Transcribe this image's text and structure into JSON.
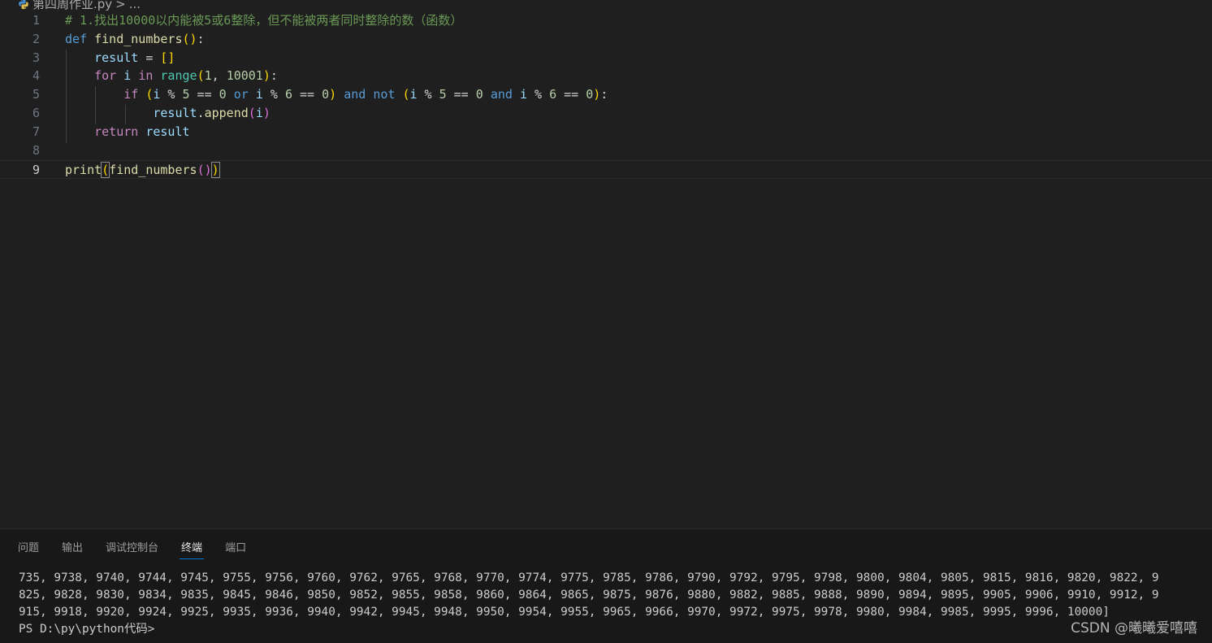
{
  "breadcrumb": {
    "file": "第四周作业.py",
    "separator": ">",
    "rest": "..."
  },
  "editor": {
    "lines": [
      {
        "n": "1",
        "tokens": [
          {
            "c": "t-comment",
            "t": "# 1.找出10000以内能被5或6整除，但不能被两者同时整除的数（函数）"
          }
        ]
      },
      {
        "n": "2",
        "tokens": [
          {
            "c": "t-def",
            "t": "def"
          },
          {
            "c": "t-plain",
            "t": " "
          },
          {
            "c": "t-fn",
            "t": "find_numbers"
          },
          {
            "c": "t-p1",
            "t": "()"
          },
          {
            "c": "t-plain",
            "t": ":"
          }
        ]
      },
      {
        "n": "3",
        "tokens": [
          {
            "c": "t-plain",
            "t": "    "
          },
          {
            "c": "t-var",
            "t": "result"
          },
          {
            "c": "t-op",
            "t": " = "
          },
          {
            "c": "t-p1",
            "t": "[]"
          }
        ]
      },
      {
        "n": "4",
        "tokens": [
          {
            "c": "t-plain",
            "t": "    "
          },
          {
            "c": "t-kw",
            "t": "for"
          },
          {
            "c": "t-plain",
            "t": " "
          },
          {
            "c": "t-var",
            "t": "i"
          },
          {
            "c": "t-plain",
            "t": " "
          },
          {
            "c": "t-kw",
            "t": "in"
          },
          {
            "c": "t-plain",
            "t": " "
          },
          {
            "c": "t-builtin",
            "t": "range"
          },
          {
            "c": "t-p1",
            "t": "("
          },
          {
            "c": "t-num",
            "t": "1"
          },
          {
            "c": "t-plain",
            "t": ", "
          },
          {
            "c": "t-num",
            "t": "10001"
          },
          {
            "c": "t-p1",
            "t": ")"
          },
          {
            "c": "t-plain",
            "t": ":"
          }
        ]
      },
      {
        "n": "5",
        "tokens": [
          {
            "c": "t-plain",
            "t": "        "
          },
          {
            "c": "t-kw",
            "t": "if"
          },
          {
            "c": "t-plain",
            "t": " "
          },
          {
            "c": "t-p1",
            "t": "("
          },
          {
            "c": "t-var",
            "t": "i"
          },
          {
            "c": "t-op",
            "t": " % "
          },
          {
            "c": "t-num",
            "t": "5"
          },
          {
            "c": "t-op",
            "t": " == "
          },
          {
            "c": "t-num",
            "t": "0"
          },
          {
            "c": "t-plain",
            "t": " "
          },
          {
            "c": "t-bool",
            "t": "or"
          },
          {
            "c": "t-plain",
            "t": " "
          },
          {
            "c": "t-var",
            "t": "i"
          },
          {
            "c": "t-op",
            "t": " % "
          },
          {
            "c": "t-num",
            "t": "6"
          },
          {
            "c": "t-op",
            "t": " == "
          },
          {
            "c": "t-num",
            "t": "0"
          },
          {
            "c": "t-p1",
            "t": ")"
          },
          {
            "c": "t-plain",
            "t": " "
          },
          {
            "c": "t-bool",
            "t": "and"
          },
          {
            "c": "t-plain",
            "t": " "
          },
          {
            "c": "t-bool",
            "t": "not"
          },
          {
            "c": "t-plain",
            "t": " "
          },
          {
            "c": "t-p1",
            "t": "("
          },
          {
            "c": "t-var",
            "t": "i"
          },
          {
            "c": "t-op",
            "t": " % "
          },
          {
            "c": "t-num",
            "t": "5"
          },
          {
            "c": "t-op",
            "t": " == "
          },
          {
            "c": "t-num",
            "t": "0"
          },
          {
            "c": "t-plain",
            "t": " "
          },
          {
            "c": "t-bool",
            "t": "and"
          },
          {
            "c": "t-plain",
            "t": " "
          },
          {
            "c": "t-var",
            "t": "i"
          },
          {
            "c": "t-op",
            "t": " % "
          },
          {
            "c": "t-num",
            "t": "6"
          },
          {
            "c": "t-op",
            "t": " == "
          },
          {
            "c": "t-num",
            "t": "0"
          },
          {
            "c": "t-p1",
            "t": ")"
          },
          {
            "c": "t-plain",
            "t": ":"
          }
        ]
      },
      {
        "n": "6",
        "tokens": [
          {
            "c": "t-plain",
            "t": "            "
          },
          {
            "c": "t-var",
            "t": "result"
          },
          {
            "c": "t-plain",
            "t": "."
          },
          {
            "c": "t-fn",
            "t": "append"
          },
          {
            "c": "t-p2",
            "t": "("
          },
          {
            "c": "t-var",
            "t": "i"
          },
          {
            "c": "t-p2",
            "t": ")"
          }
        ]
      },
      {
        "n": "7",
        "tokens": [
          {
            "c": "t-plain",
            "t": "    "
          },
          {
            "c": "t-kw",
            "t": "return"
          },
          {
            "c": "t-plain",
            "t": " "
          },
          {
            "c": "t-var",
            "t": "result"
          }
        ]
      },
      {
        "n": "8",
        "tokens": []
      },
      {
        "n": "9",
        "tokens": [
          {
            "c": "t-fn",
            "t": "print"
          },
          {
            "c": "t-p1 match-br",
            "t": "("
          },
          {
            "c": "t-fn",
            "t": "find_numbers"
          },
          {
            "c": "t-p2",
            "t": "()"
          },
          {
            "c": "t-p1 match-br",
            "t": ")"
          }
        ]
      }
    ],
    "active_line": "9"
  },
  "panel": {
    "tabs": [
      {
        "label": "问题",
        "active": false
      },
      {
        "label": "输出",
        "active": false
      },
      {
        "label": "调试控制台",
        "active": false
      },
      {
        "label": "终端",
        "active": true
      },
      {
        "label": "端口",
        "active": false
      }
    ],
    "terminal_lines": [
      "735, 9738, 9740, 9744, 9745, 9755, 9756, 9760, 9762, 9765, 9768, 9770, 9774, 9775, 9785, 9786, 9790, 9792, 9795, 9798, 9800, 9804, 9805, 9815, 9816, 9820, 9822, 9",
      "825, 9828, 9830, 9834, 9835, 9845, 9846, 9850, 9852, 9855, 9858, 9860, 9864, 9865, 9875, 9876, 9880, 9882, 9885, 9888, 9890, 9894, 9895, 9905, 9906, 9910, 9912, 9",
      "915, 9918, 9920, 9924, 9925, 9935, 9936, 9940, 9942, 9945, 9948, 9950, 9954, 9955, 9965, 9966, 9970, 9972, 9975, 9978, 9980, 9984, 9985, 9995, 9996, 10000]",
      "PS D:\\py\\python代码>"
    ]
  },
  "watermark": "CSDN @曦曦爱嘻嘻"
}
